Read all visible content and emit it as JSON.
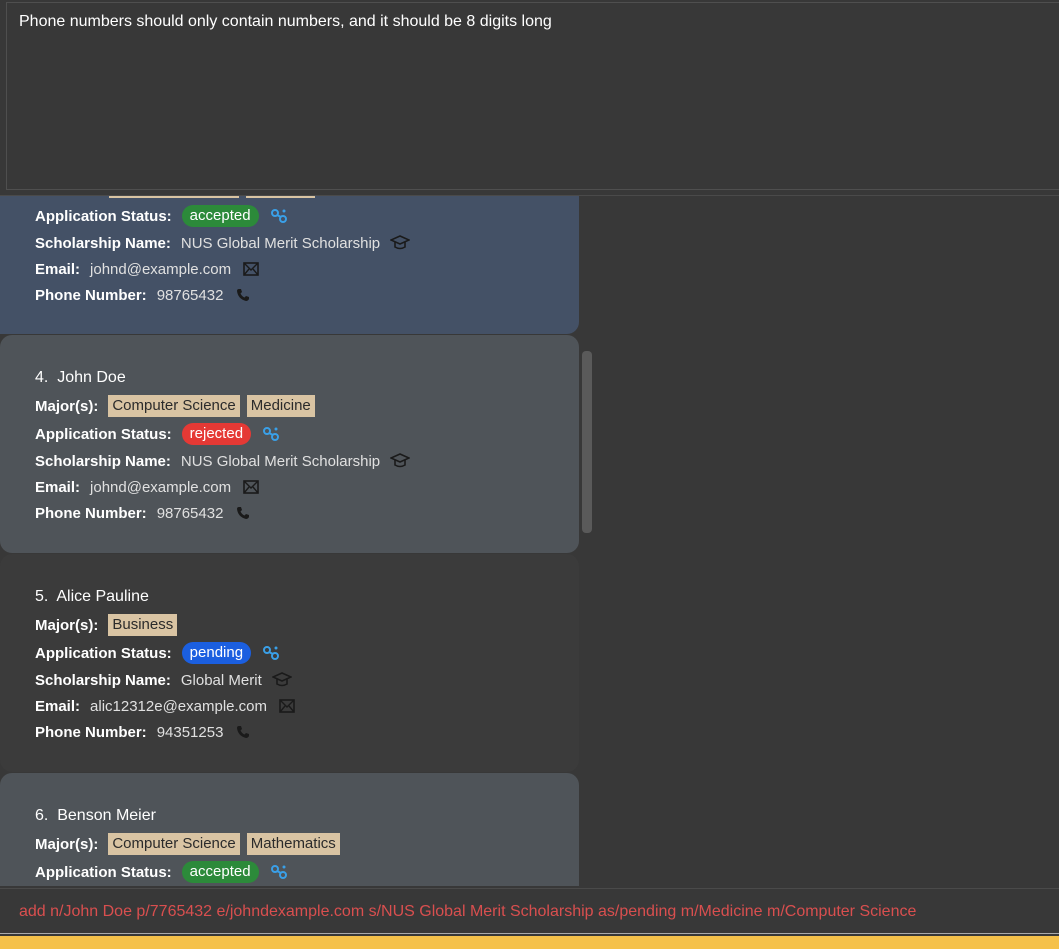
{
  "result": {
    "message": "Phone numbers should only contain numbers, and it should be 8 digits long"
  },
  "labels": {
    "majors": "Major(s):",
    "status": "Application Status:",
    "scholarship": "Scholarship Name:",
    "email": "Email:",
    "phone": "Phone Number:"
  },
  "cards": [
    {
      "status": "accepted",
      "scholarship": "NUS Global Merit Scholarship",
      "email": "johnd@example.com",
      "phone": "98765432"
    },
    {
      "index": "4.",
      "name": "John Doe",
      "majors": [
        "Computer Science",
        "Medicine"
      ],
      "status": "rejected",
      "scholarship": "NUS Global Merit Scholarship",
      "email": "johnd@example.com",
      "phone": "98765432"
    },
    {
      "index": "5.",
      "name": "Alice Pauline",
      "majors": [
        "Business"
      ],
      "status": "pending",
      "scholarship": "Global Merit",
      "email": "alic12312e@example.com",
      "phone": "94351253"
    },
    {
      "index": "6.",
      "name": "Benson Meier",
      "majors": [
        "Computer Science",
        "Mathematics"
      ],
      "status": "accepted"
    }
  ],
  "command": {
    "value": "add n/John Doe p/7765432 e/johndexample.com s/NUS Global Merit Scholarship as/pending m/Medicine m/Computer Science"
  },
  "colors": {
    "accepted": "#2c8a3a",
    "rejected": "#e53935",
    "pending": "#1b5fe0",
    "tag": "#d9c4a3",
    "error_text": "#d94f4f",
    "status_bar": "#f5c14a"
  },
  "icons": [
    "status-icon",
    "scholarship-icon",
    "email-icon",
    "phone-icon"
  ]
}
